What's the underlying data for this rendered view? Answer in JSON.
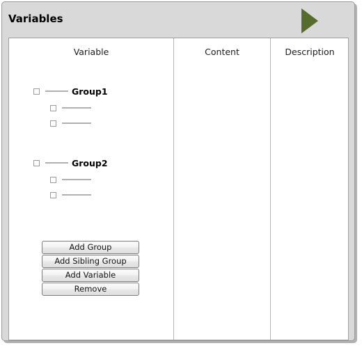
{
  "window": {
    "title": "Variables",
    "run_icon": "play-triangle-icon",
    "accent_color": "#566c2f",
    "frame_bg": "#d9d9d9",
    "panel_bg": "#ffffff"
  },
  "table": {
    "columns": [
      {
        "label": "Variable"
      },
      {
        "label": "Content"
      },
      {
        "label": "Description"
      }
    ]
  },
  "tree": {
    "nodes": [
      {
        "label": "Group1",
        "checkbox": "unchecked",
        "children": [
          {
            "label": "",
            "checkbox": "unchecked"
          },
          {
            "label": "",
            "checkbox": "unchecked"
          }
        ]
      },
      {
        "label": "Group2",
        "checkbox": "unchecked",
        "children": [
          {
            "label": "",
            "checkbox": "unchecked"
          },
          {
            "label": "",
            "checkbox": "unchecked"
          }
        ]
      }
    ]
  },
  "buttons": [
    {
      "label": "Add Group"
    },
    {
      "label": "Add Sibling Group"
    },
    {
      "label": "Add Variable"
    },
    {
      "label": "Remove"
    }
  ]
}
